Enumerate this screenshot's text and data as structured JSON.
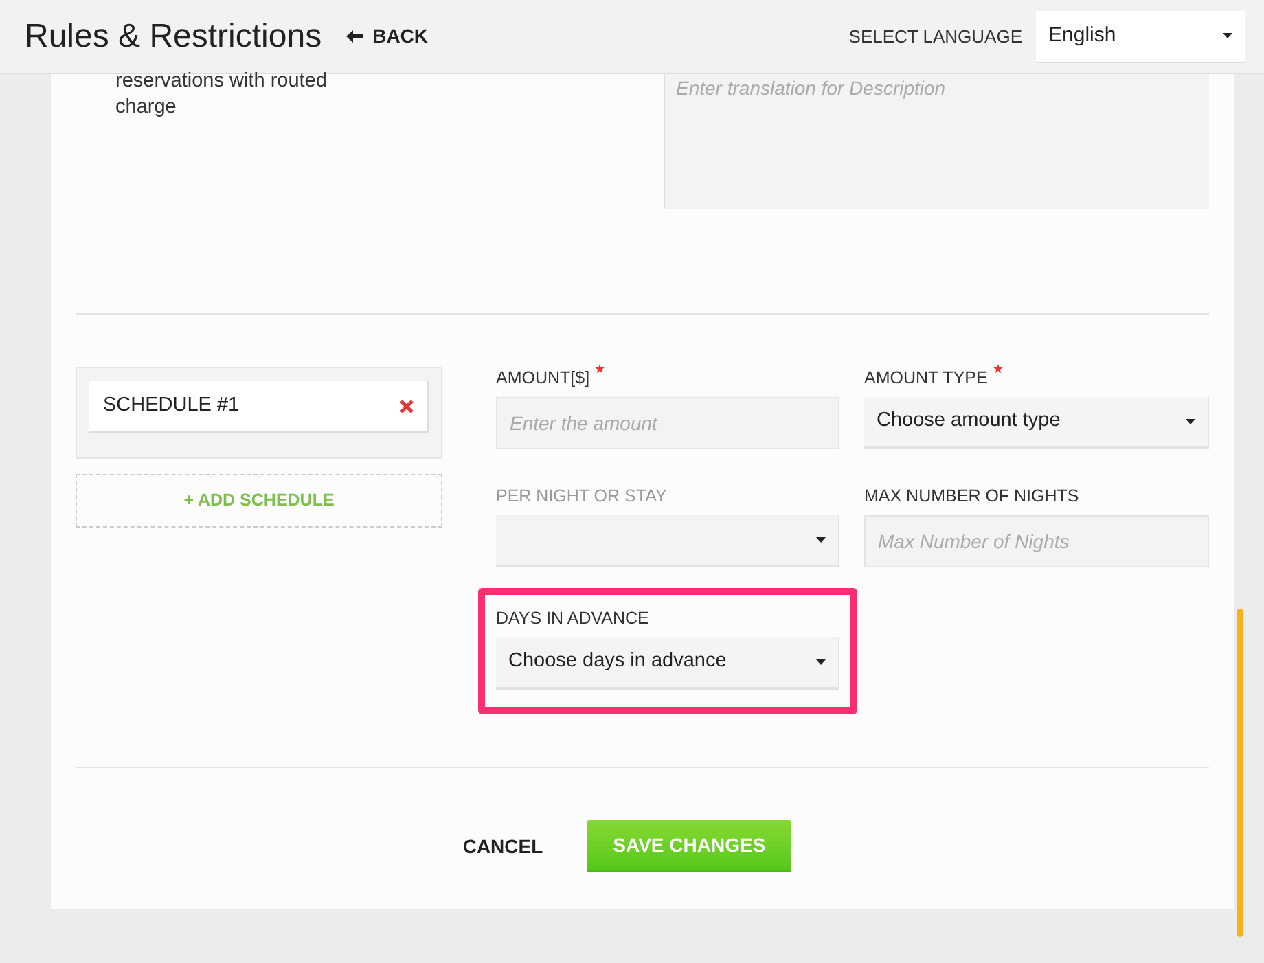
{
  "header": {
    "title": "Rules & Restrictions",
    "back": "BACK",
    "language_label": "SELECT LANGUAGE",
    "language": "English"
  },
  "description": {
    "text": "reservations with routed charge",
    "translation_placeholder": "Enter translation for Description"
  },
  "schedules": [
    {
      "label": "SCHEDULE #1"
    }
  ],
  "add_schedule": "+ ADD SCHEDULE",
  "fields": [
    {
      "kind": "input",
      "label": "AMOUNT[$]",
      "required": true,
      "disabled": false,
      "highlighted": false,
      "placeholder": "Enter the amount"
    },
    {
      "kind": "select",
      "label": "AMOUNT TYPE",
      "required": true,
      "disabled": false,
      "highlighted": false,
      "value": "Choose amount type"
    },
    {
      "kind": "select",
      "label": "PER NIGHT OR STAY",
      "required": false,
      "disabled": true,
      "highlighted": false
    },
    {
      "kind": "input",
      "label": "MAX NUMBER OF NIGHTS",
      "required": false,
      "disabled": false,
      "highlighted": false,
      "placeholder": "Max Number of Nights"
    },
    {
      "kind": "select",
      "label": "DAYS IN ADVANCE",
      "required": false,
      "disabled": false,
      "highlighted": true,
      "value": "Choose days in advance"
    }
  ],
  "buttons": {
    "cancel": "CANCEL",
    "save": "SAVE CHANGES"
  }
}
